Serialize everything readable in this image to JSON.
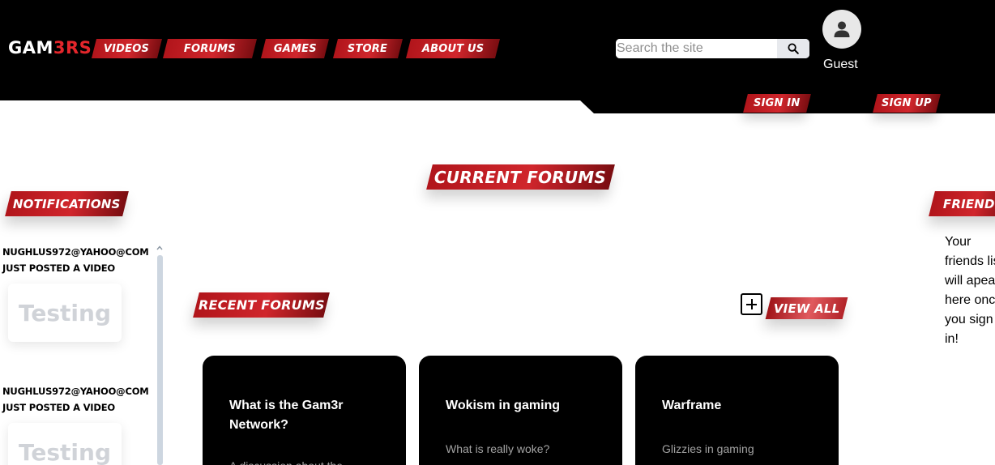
{
  "header": {
    "logo_main": "GAM",
    "logo_accent": "3RS",
    "nav": [
      "VIDEOS",
      "FORUMS",
      "GAMES",
      "STORE",
      "ABOUT US"
    ],
    "search_placeholder": "Search the site",
    "user_name": "Guest",
    "sign_in": "SIGN IN",
    "sign_up": "SIGN UP"
  },
  "sections": {
    "current_forums": "CURRENT FORUMS",
    "notifications": "NOTIFICATIONS",
    "friends": "FRIENDS",
    "recent_forums": "RECENT FORUMS",
    "view_all": "VIEW ALL"
  },
  "notifications": [
    {
      "user": "NUGHLUS972@YAHOO@COM",
      "action": "JUST POSTED A VIDEO",
      "preview": "Testing"
    },
    {
      "user": "NUGHLUS972@YAHOO@COM",
      "action": "JUST POSTED A VIDEO",
      "preview": "Testing"
    }
  ],
  "friends_text": "Your friends list will apear here once you sign in!",
  "forums": [
    {
      "title": "What is the Gam3r Network?",
      "desc": "A discussion about the"
    },
    {
      "title": "Wokism in gaming",
      "desc": "What is really woke?"
    },
    {
      "title": "Warframe",
      "desc": "Glizzies in gaming"
    }
  ],
  "colors": {
    "brand_red": "#d0262c",
    "header_bg": "#000000"
  }
}
